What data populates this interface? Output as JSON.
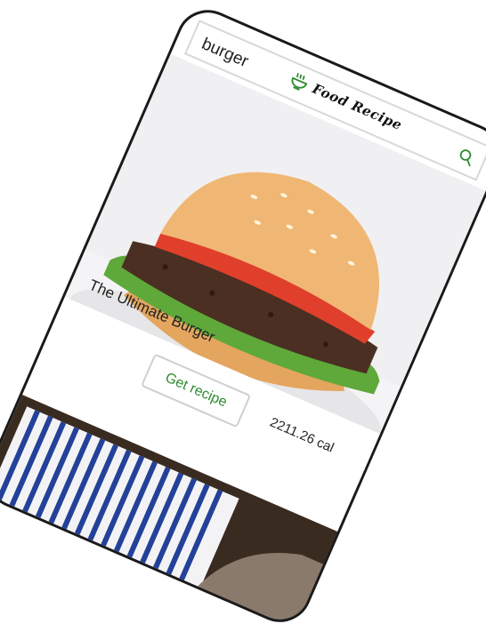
{
  "app": {
    "brand_name": "Food Recipe",
    "accent_color": "#2e8b2e"
  },
  "search": {
    "value": "burger",
    "icon": "search-icon"
  },
  "recipes": [
    {
      "title": "The Ultimate Burger",
      "button_label": "Get recipe",
      "calories": "2211.26 cal"
    }
  ]
}
